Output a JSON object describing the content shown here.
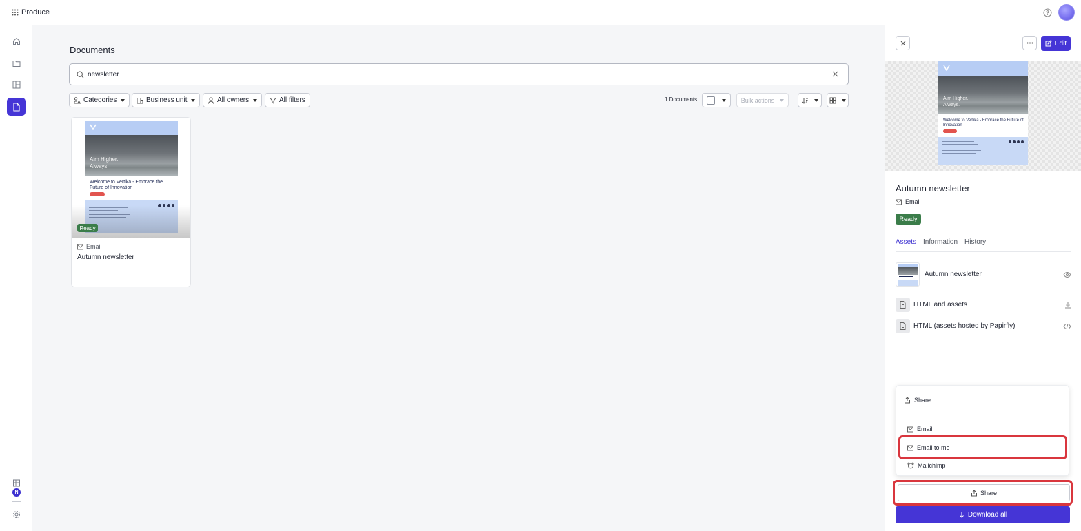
{
  "app": {
    "name": "Produce"
  },
  "page": {
    "title": "Documents"
  },
  "search": {
    "value": "newsletter",
    "placeholder": "Search"
  },
  "filters": {
    "categories": "Categories",
    "business_unit": "Business unit",
    "owners": "All owners",
    "all_filters": "All filters"
  },
  "toolbar": {
    "count": "1 Documents",
    "bulk_actions": "Bulk actions"
  },
  "documents": [
    {
      "type": "Email",
      "title": "Autumn newsletter",
      "status": "Ready"
    }
  ],
  "newsletter_preview": {
    "hero_line1": "Aim Higher.",
    "hero_line2": "Always.",
    "welcome": "Welcome to Vertika - Embrace the Future of Innovation"
  },
  "panel": {
    "edit_label": "Edit",
    "title": "Autumn newsletter",
    "type": "Email",
    "status": "Ready",
    "tabs": [
      "Assets",
      "Information",
      "History"
    ],
    "assets": [
      {
        "label": "Autumn newsletter",
        "action_icon": "eye-icon"
      },
      {
        "label": "HTML and assets",
        "action_icon": "download-icon"
      },
      {
        "label": "HTML (assets hosted by Papirfly)",
        "action_icon": "code-icon"
      }
    ],
    "share_menu": {
      "header": "Share",
      "items": [
        "Email",
        "Email to me",
        "Mailchimp"
      ]
    },
    "share_button": "Share",
    "download_button": "Download all"
  },
  "colors": {
    "accent": "#4535d6",
    "ready": "#3b7d4a",
    "highlight": "#d9363e"
  }
}
